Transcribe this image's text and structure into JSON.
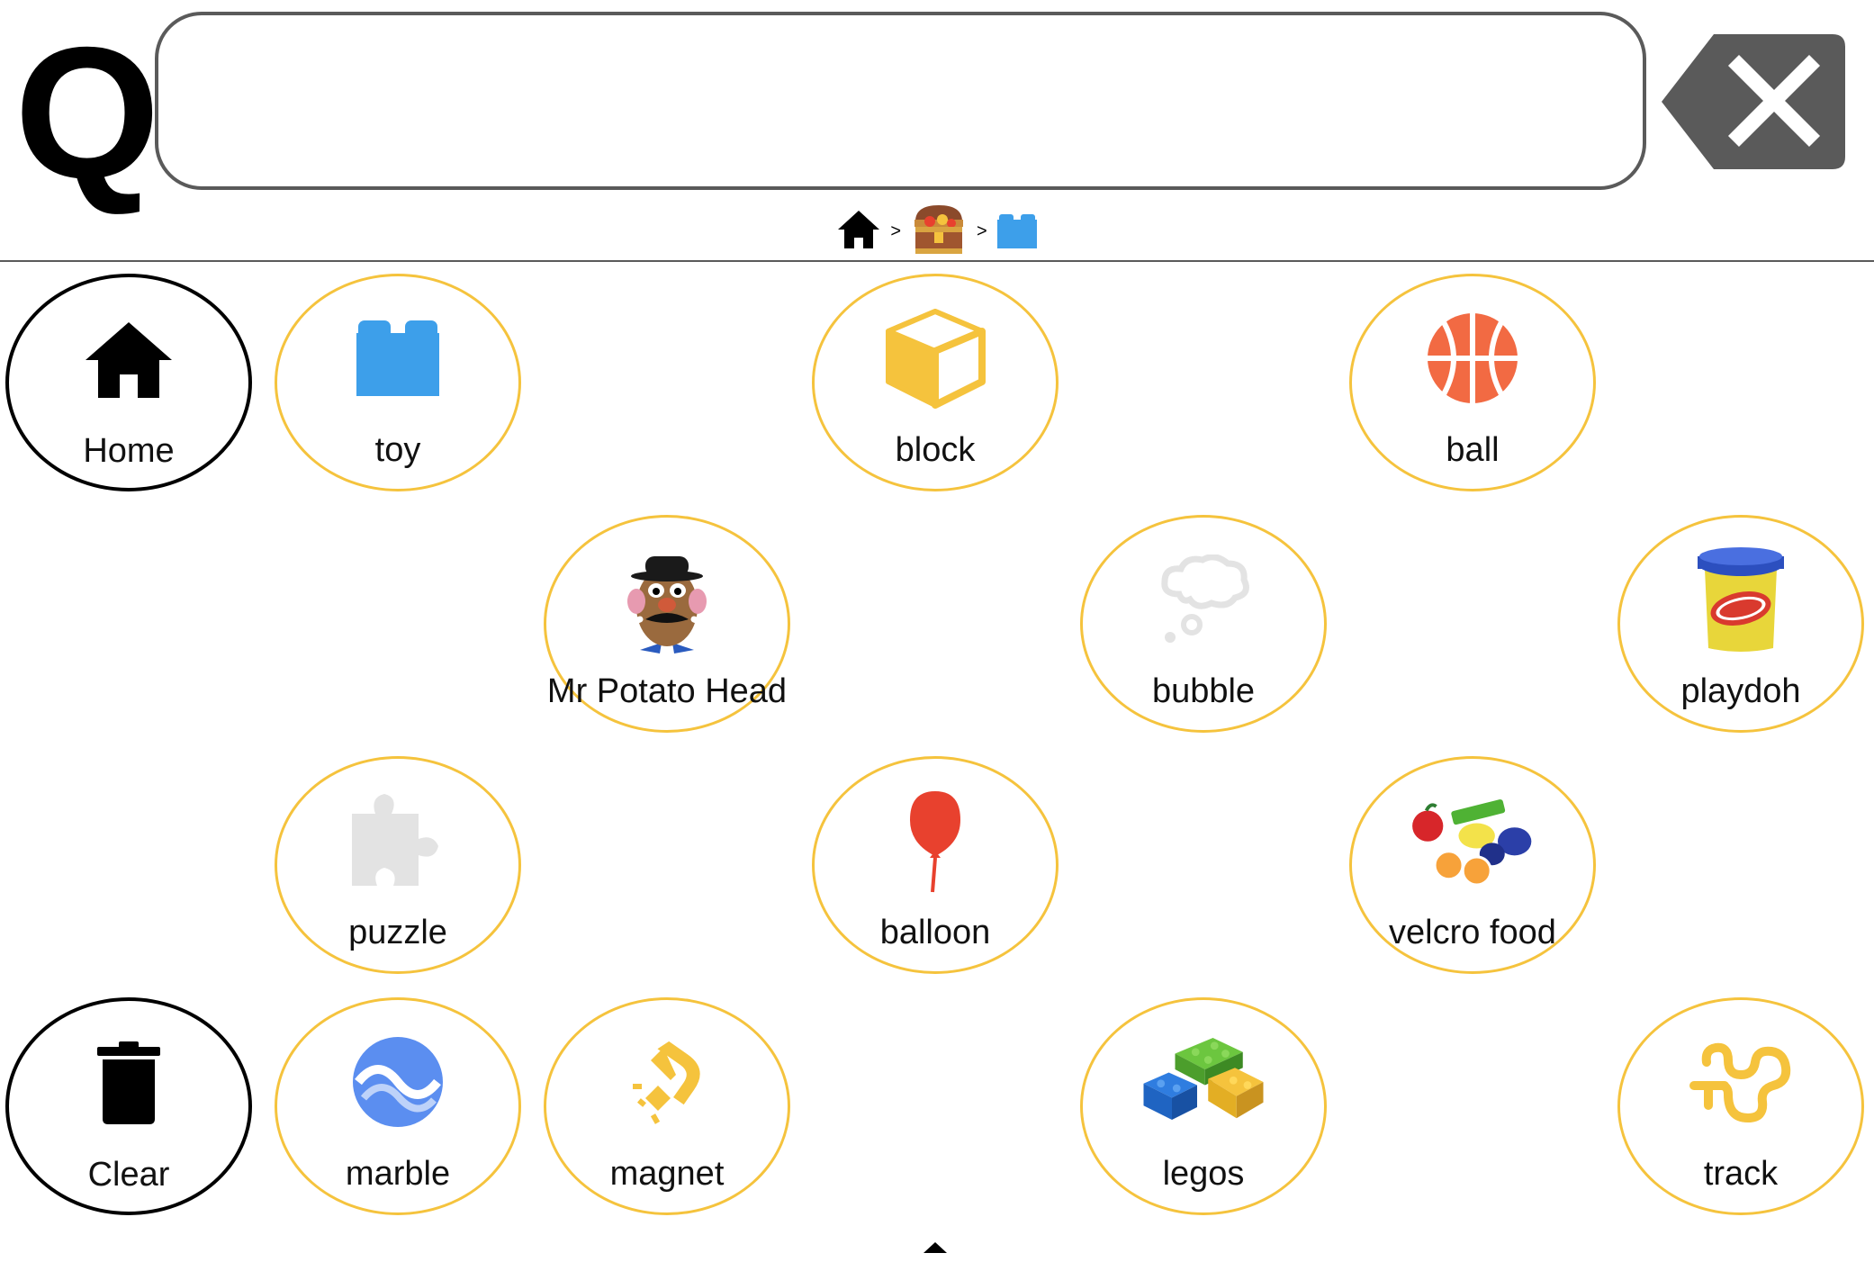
{
  "header": {
    "logo_letter": "Q",
    "message_text": "",
    "backspace_icon": "backspace-icon"
  },
  "breadcrumb": {
    "items": [
      "home-icon",
      "treasure-chest-icon",
      "blue-block-icon"
    ],
    "separator": ">"
  },
  "colors": {
    "category_border": "#f5c33d",
    "utility_border": "#000000",
    "toy_blue": "#3d9fea",
    "block_yellow": "#f5c33d",
    "ball_orange": "#f26a43",
    "balloon_red": "#e8412e",
    "marble_blue": "#5b8ef0",
    "track_yellow": "#f5c33d",
    "backspace_gray": "#5a5a5a"
  },
  "tiles": {
    "home": {
      "label": "Home",
      "icon": "home-icon"
    },
    "toy": {
      "label": "toy",
      "icon": "toy-block-icon"
    },
    "block": {
      "label": "block",
      "icon": "cube-icon"
    },
    "ball": {
      "label": "ball",
      "icon": "basketball-icon"
    },
    "mr_potato_head": {
      "label": "Mr Potato Head",
      "icon": "mr-potato-head-image"
    },
    "bubble": {
      "label": "bubble",
      "icon": "thought-bubble-icon"
    },
    "playdoh": {
      "label": "playdoh",
      "icon": "playdoh-can-image"
    },
    "puzzle": {
      "label": "puzzle",
      "icon": "puzzle-piece-icon"
    },
    "balloon": {
      "label": "balloon",
      "icon": "balloon-icon"
    },
    "velcro_food": {
      "label": "velcro food",
      "icon": "velcro-food-image"
    },
    "clear": {
      "label": "Clear",
      "icon": "trash-icon"
    },
    "marble": {
      "label": "marble",
      "icon": "marble-icon"
    },
    "magnet": {
      "label": "magnet",
      "icon": "magnet-icon"
    },
    "legos": {
      "label": "legos",
      "icon": "legos-image"
    },
    "track": {
      "label": "track",
      "icon": "track-icon"
    }
  }
}
